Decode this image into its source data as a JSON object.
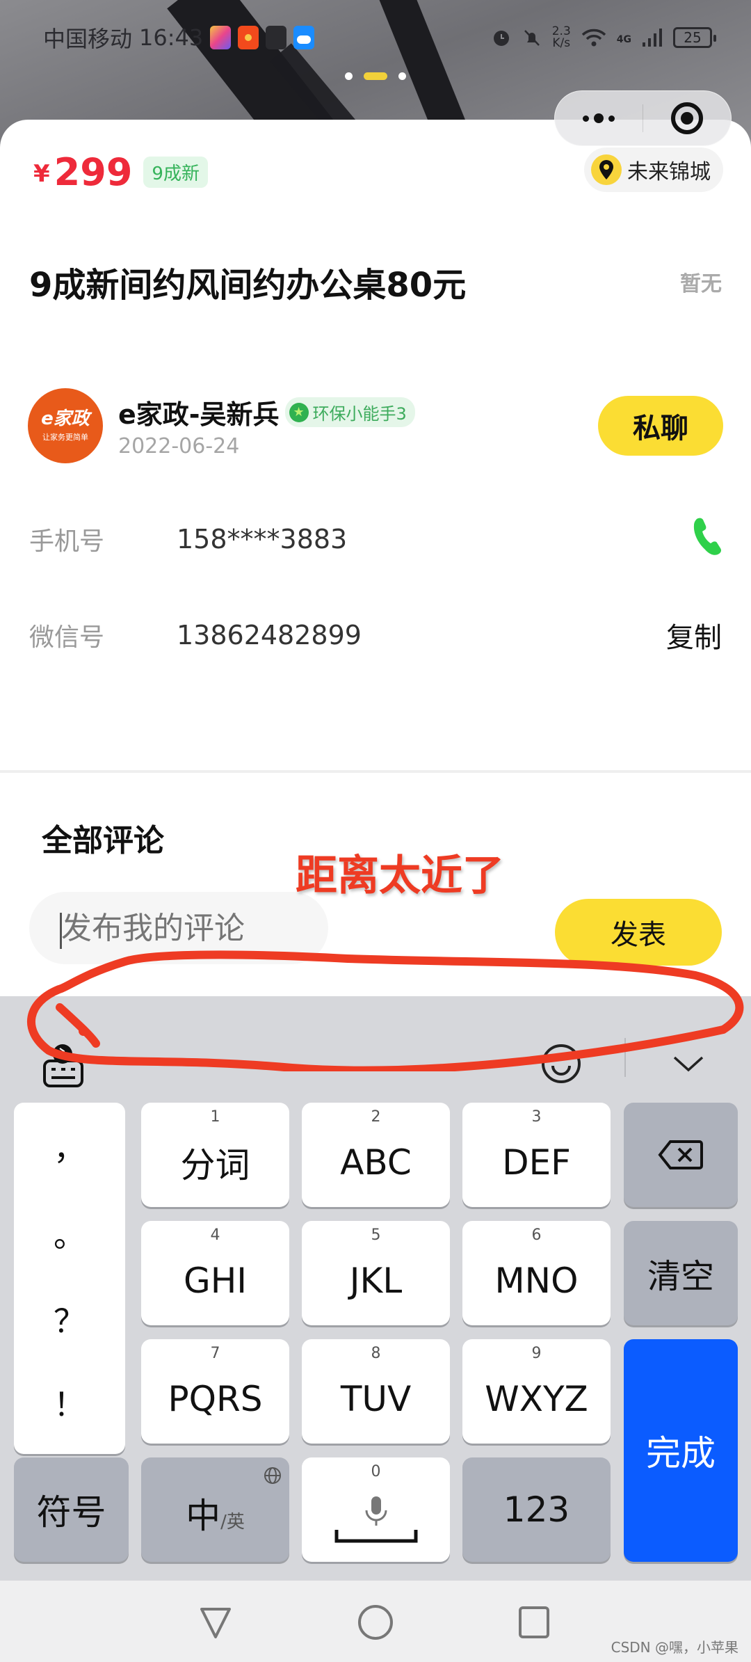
{
  "status_bar": {
    "carrier": "中国移动",
    "time": "16:43",
    "net_speed_value": "2.3",
    "net_speed_unit": "K/s",
    "network_type": "4G",
    "battery": "25",
    "app_icons": [
      "paint-app-icon",
      "red-envelope-icon",
      "video-app-icon",
      "weather-icon"
    ]
  },
  "page_indicator": {
    "count": 3,
    "active_index": 1
  },
  "capsule": {
    "more_icon": "more-dots-icon",
    "close_icon": "close-target-icon"
  },
  "listing": {
    "currency": "¥",
    "price": "299",
    "condition_tag": "9成新",
    "location": "未来锦城",
    "title": "9成新间约风间约办公桌80元",
    "title_aside": "暂无"
  },
  "seller": {
    "avatar_logo": "e家政",
    "avatar_slogan": "让家务更简单",
    "name": "e家政-吴新兵",
    "badge": "环保小能手3",
    "date": "2022-06-24",
    "chat_label": "私聊"
  },
  "contacts": [
    {
      "label": "手机号",
      "value": "158****3883",
      "action_icon": "phone-icon"
    },
    {
      "label": "微信号",
      "value": "13862482899",
      "action_label": "复制"
    }
  ],
  "comments": {
    "title": "全部评论",
    "input_placeholder": "发布我的评论",
    "publish_label": "发表"
  },
  "annotation": {
    "text": "距离太近了",
    "color": "#ee3b23"
  },
  "keyboard": {
    "punctuation": [
      "，",
      "。",
      "？",
      "！"
    ],
    "keys": [
      {
        "num": "1",
        "label": "分词"
      },
      {
        "num": "2",
        "label": "ABC"
      },
      {
        "num": "3",
        "label": "DEF"
      },
      {
        "num": "4",
        "label": "GHI"
      },
      {
        "num": "5",
        "label": "JKL"
      },
      {
        "num": "6",
        "label": "MNO"
      },
      {
        "num": "7",
        "label": "PQRS"
      },
      {
        "num": "8",
        "label": "TUV"
      },
      {
        "num": "9",
        "label": "WXYZ"
      }
    ],
    "clear_label": "清空",
    "symbols_label": "符号",
    "lang_main": "中",
    "lang_sub": "/英",
    "space_num": "0",
    "numbers_label": "123",
    "done_label": "完成"
  },
  "watermark": "CSDN @嘿，小苹果",
  "colors": {
    "price": "#ee2a3a",
    "accent_yellow": "#fbdd33",
    "badge_green": "#3dab5c",
    "phone_green": "#2fd04a",
    "done_blue": "#0b5cff"
  }
}
